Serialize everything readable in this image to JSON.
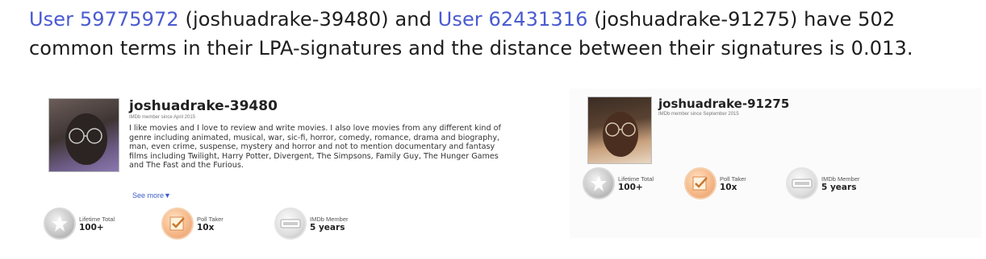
{
  "headline": {
    "user1_link": "User 59775972",
    "user1_handle": " (joshuadrake-39480) and ",
    "user2_link": "User 62431316",
    "user2_handle": " (joshuadrake-91275) have 502 common terms in their LPA-signatures and the distance between their signatures is 0.013."
  },
  "card1": {
    "username": "joshuadrake-39480",
    "since": "IMDb member since April 2015",
    "bio": "I like movies and I love to review and write movies. I also love movies from any different kind of genre including animated, musical, war, sic-fi, horror, comedy, romance, drama and biography, man, even crime, suspense, mystery and horror and not to mention documentary and fantasy films including Twilight, Harry Potter, Divergent, The Simpsons, Family Guy, The Hunger Games and The Fast and the Furious.",
    "see_more": "See more▼",
    "badges": [
      {
        "label": "Lifetime Total",
        "value": "100+",
        "icon": "lifetime-total-icon"
      },
      {
        "label": "Poll Taker",
        "value": "10x",
        "icon": "poll-taker-icon"
      },
      {
        "label": "IMDb Member",
        "value": "5 years",
        "icon": "imdb-member-icon"
      }
    ]
  },
  "card2": {
    "username": "joshuadrake-91275",
    "since": "IMDb member since September 2015",
    "badges": [
      {
        "label": "Lifetime Total",
        "value": "100+",
        "icon": "lifetime-total-icon"
      },
      {
        "label": "Poll Taker",
        "value": "10x",
        "icon": "poll-taker-icon"
      },
      {
        "label": "IMDb Member",
        "value": "5 years",
        "icon": "imdb-member-icon"
      }
    ]
  },
  "colors": {
    "link": "#4a5ad0",
    "see_more": "#3c5ec6"
  }
}
